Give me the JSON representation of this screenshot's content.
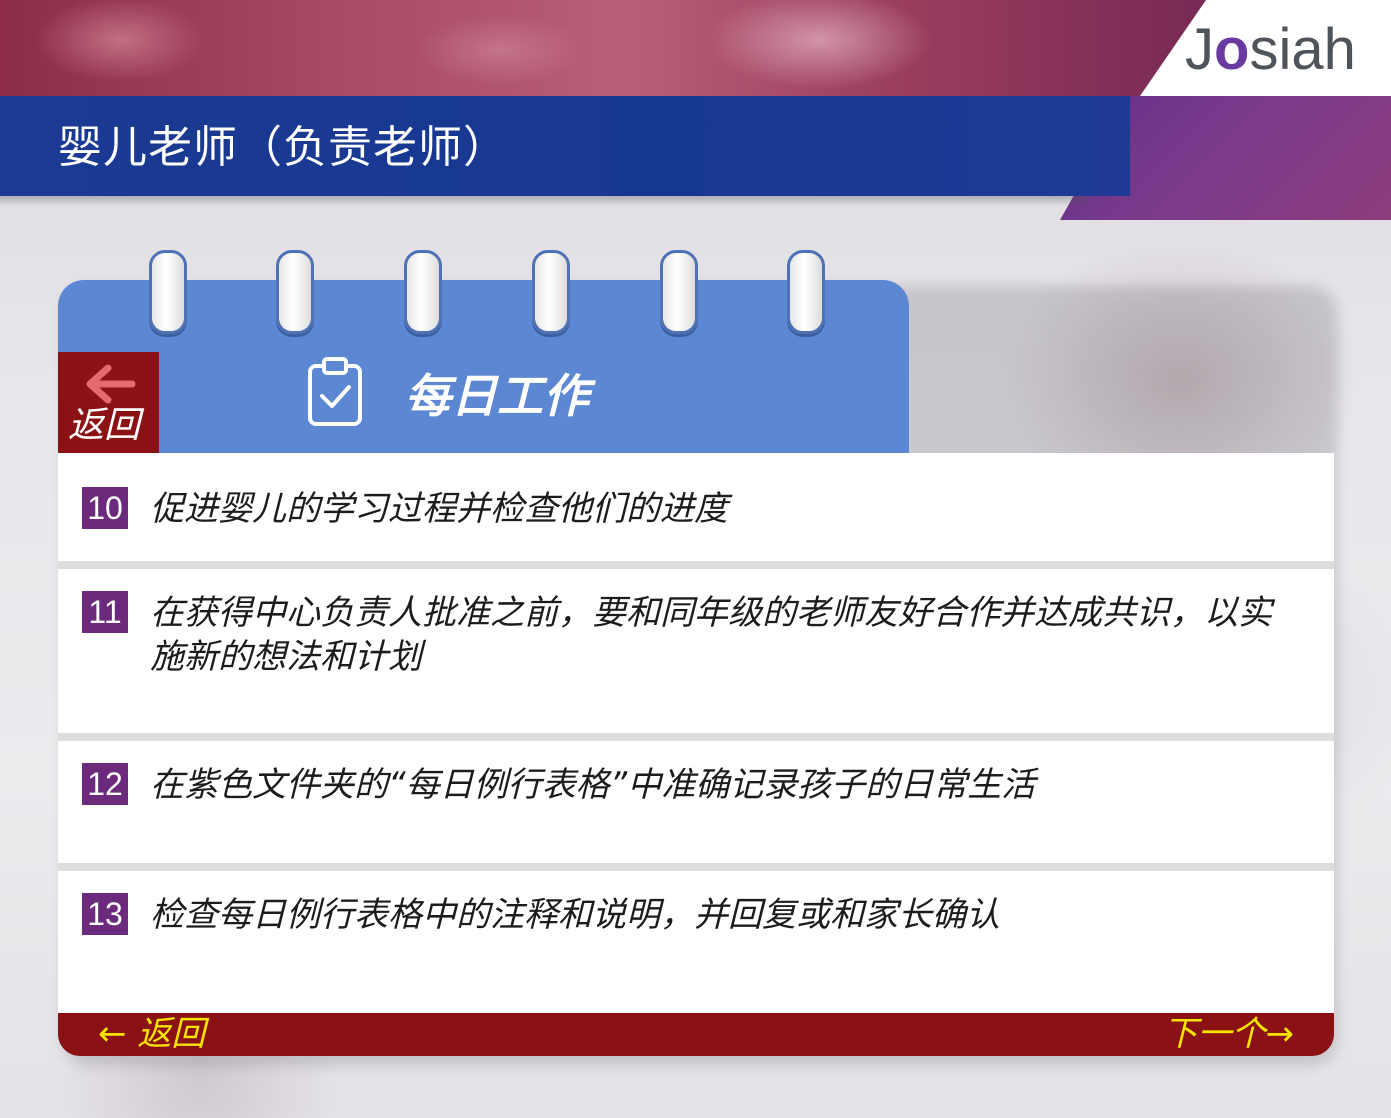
{
  "header": {
    "title": "婴儿老师（负责老师）",
    "logo_prefix": "J",
    "logo_mark": "o",
    "logo_suffix": "siah"
  },
  "card": {
    "back_tab_label": "返回",
    "heading": "每日工作",
    "heading_icon": "clipboard-check-icon"
  },
  "tasks": [
    {
      "number": "10",
      "text": "促进婴儿的学习过程并检查他们的进度"
    },
    {
      "number": "11",
      "text": "在获得中心负责人批准之前，要和同年级的老师友好合作并达成共识，以实施新的想法和计划"
    },
    {
      "number": "12",
      "text": "在紫色文件夹的“每日例行表格”中准确记录孩子的日常生活"
    },
    {
      "number": "13",
      "text": "检查每日例行表格中的注释和说明，并回复或和家长确认"
    }
  ],
  "footer": {
    "back_label": "← 返回",
    "next_label": "下一个→"
  },
  "colors": {
    "title_bar": "#1b3a93",
    "calendar_head": "#5b87d3",
    "dark_red": "#8b1214",
    "number_badge": "#6b2a7c",
    "footer_text": "#f6e400"
  }
}
